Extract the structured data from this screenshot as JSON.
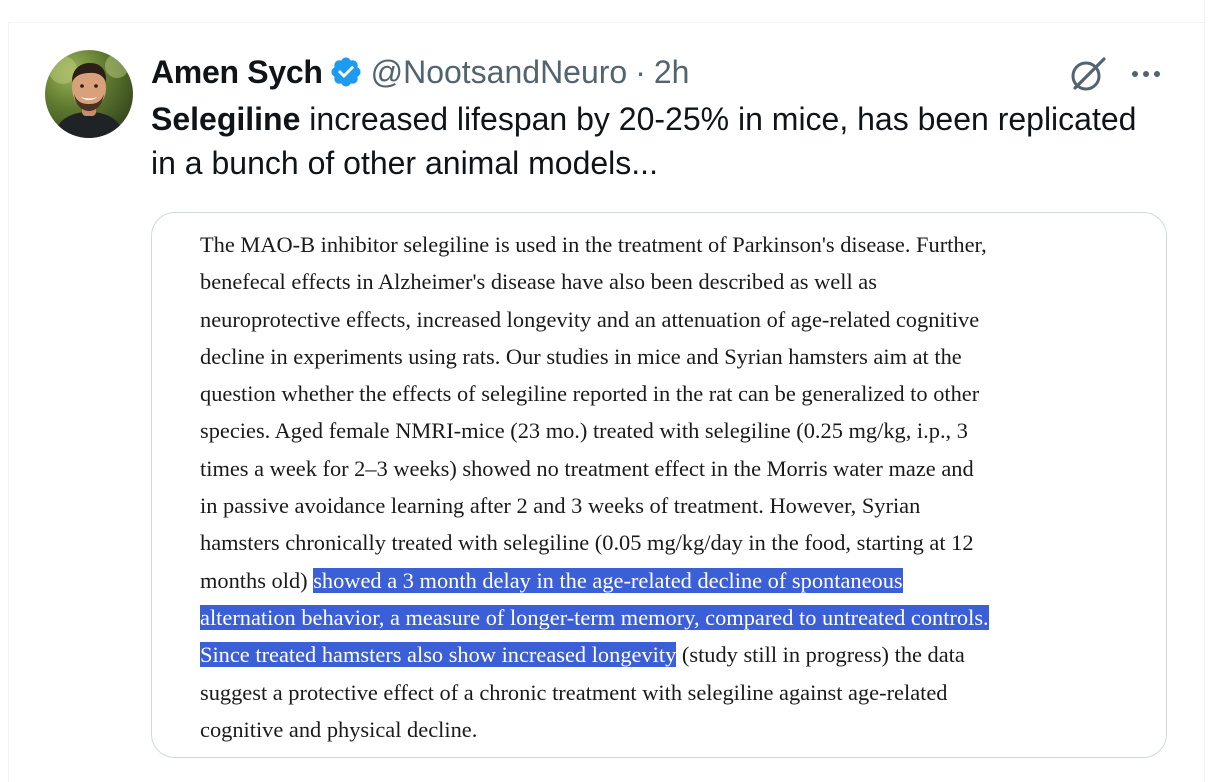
{
  "tweet": {
    "author_name": "Amen Sych",
    "handle": "@NootsandNeuro",
    "separator": "·",
    "time": "2h",
    "text_bold": "Selegiline",
    "text_rest": " increased lifespan by 20-25% in mice, has been replicated in a bunch of other animal models...",
    "icons": {
      "avatar": "profile-photo",
      "verified": "verified-badge-icon",
      "grok": "grok-icon",
      "more": "more-options-icon"
    },
    "colors": {
      "verified": "#1d9bf0",
      "secondary_text": "#536471",
      "highlight": "#3b5fd6"
    }
  },
  "abstract": {
    "lines": [
      {
        "a": "The MAO-B inhibitor selegiline is used in the treatment of Parkinson's disease. Further,",
        "h": "",
        "b": ""
      },
      {
        "a": "benefecal effects in Alzheimer's disease have also been described as well as",
        "h": "",
        "b": ""
      },
      {
        "a": "neuroprotective effects, increased longevity and an attenuation of age-related cognitive",
        "h": "",
        "b": ""
      },
      {
        "a": "decline in experiments using rats. Our studies in mice and Syrian hamsters aim at the",
        "h": "",
        "b": ""
      },
      {
        "a": "question whether the effects of selegiline reported in the rat can be generalized to other",
        "h": "",
        "b": ""
      },
      {
        "a": "species. Aged female NMRI-mice (23 mo.) treated with selegiline (0.25 mg/kg, i.p., 3",
        "h": "",
        "b": ""
      },
      {
        "a": "times a week for 2–3 weeks) showed no treatment effect in the Morris water maze and",
        "h": "",
        "b": ""
      },
      {
        "a": "in passive avoidance learning after 2 and 3 weeks of treatment. However, Syrian",
        "h": "",
        "b": ""
      },
      {
        "a": "hamsters chronically treated with selegiline (0.05 mg/kg/day in the food, starting at 12",
        "h": "",
        "b": ""
      },
      {
        "a": "months old) ",
        "h": "showed a 3 month delay in the age-related decline of spontaneous",
        "b": ""
      },
      {
        "a": "",
        "h": "alternation behavior, a measure of longer-term memory, compared to untreated controls.",
        "b": ""
      },
      {
        "a": "",
        "h": "Since treated hamsters also show increased longevity",
        "b": " (study still in progress) the data"
      },
      {
        "a": "suggest a protective effect of a chronic treatment with selegiline against age-related",
        "h": "",
        "b": ""
      },
      {
        "a": "cognitive and physical decline.",
        "h": "",
        "b": ""
      }
    ]
  }
}
